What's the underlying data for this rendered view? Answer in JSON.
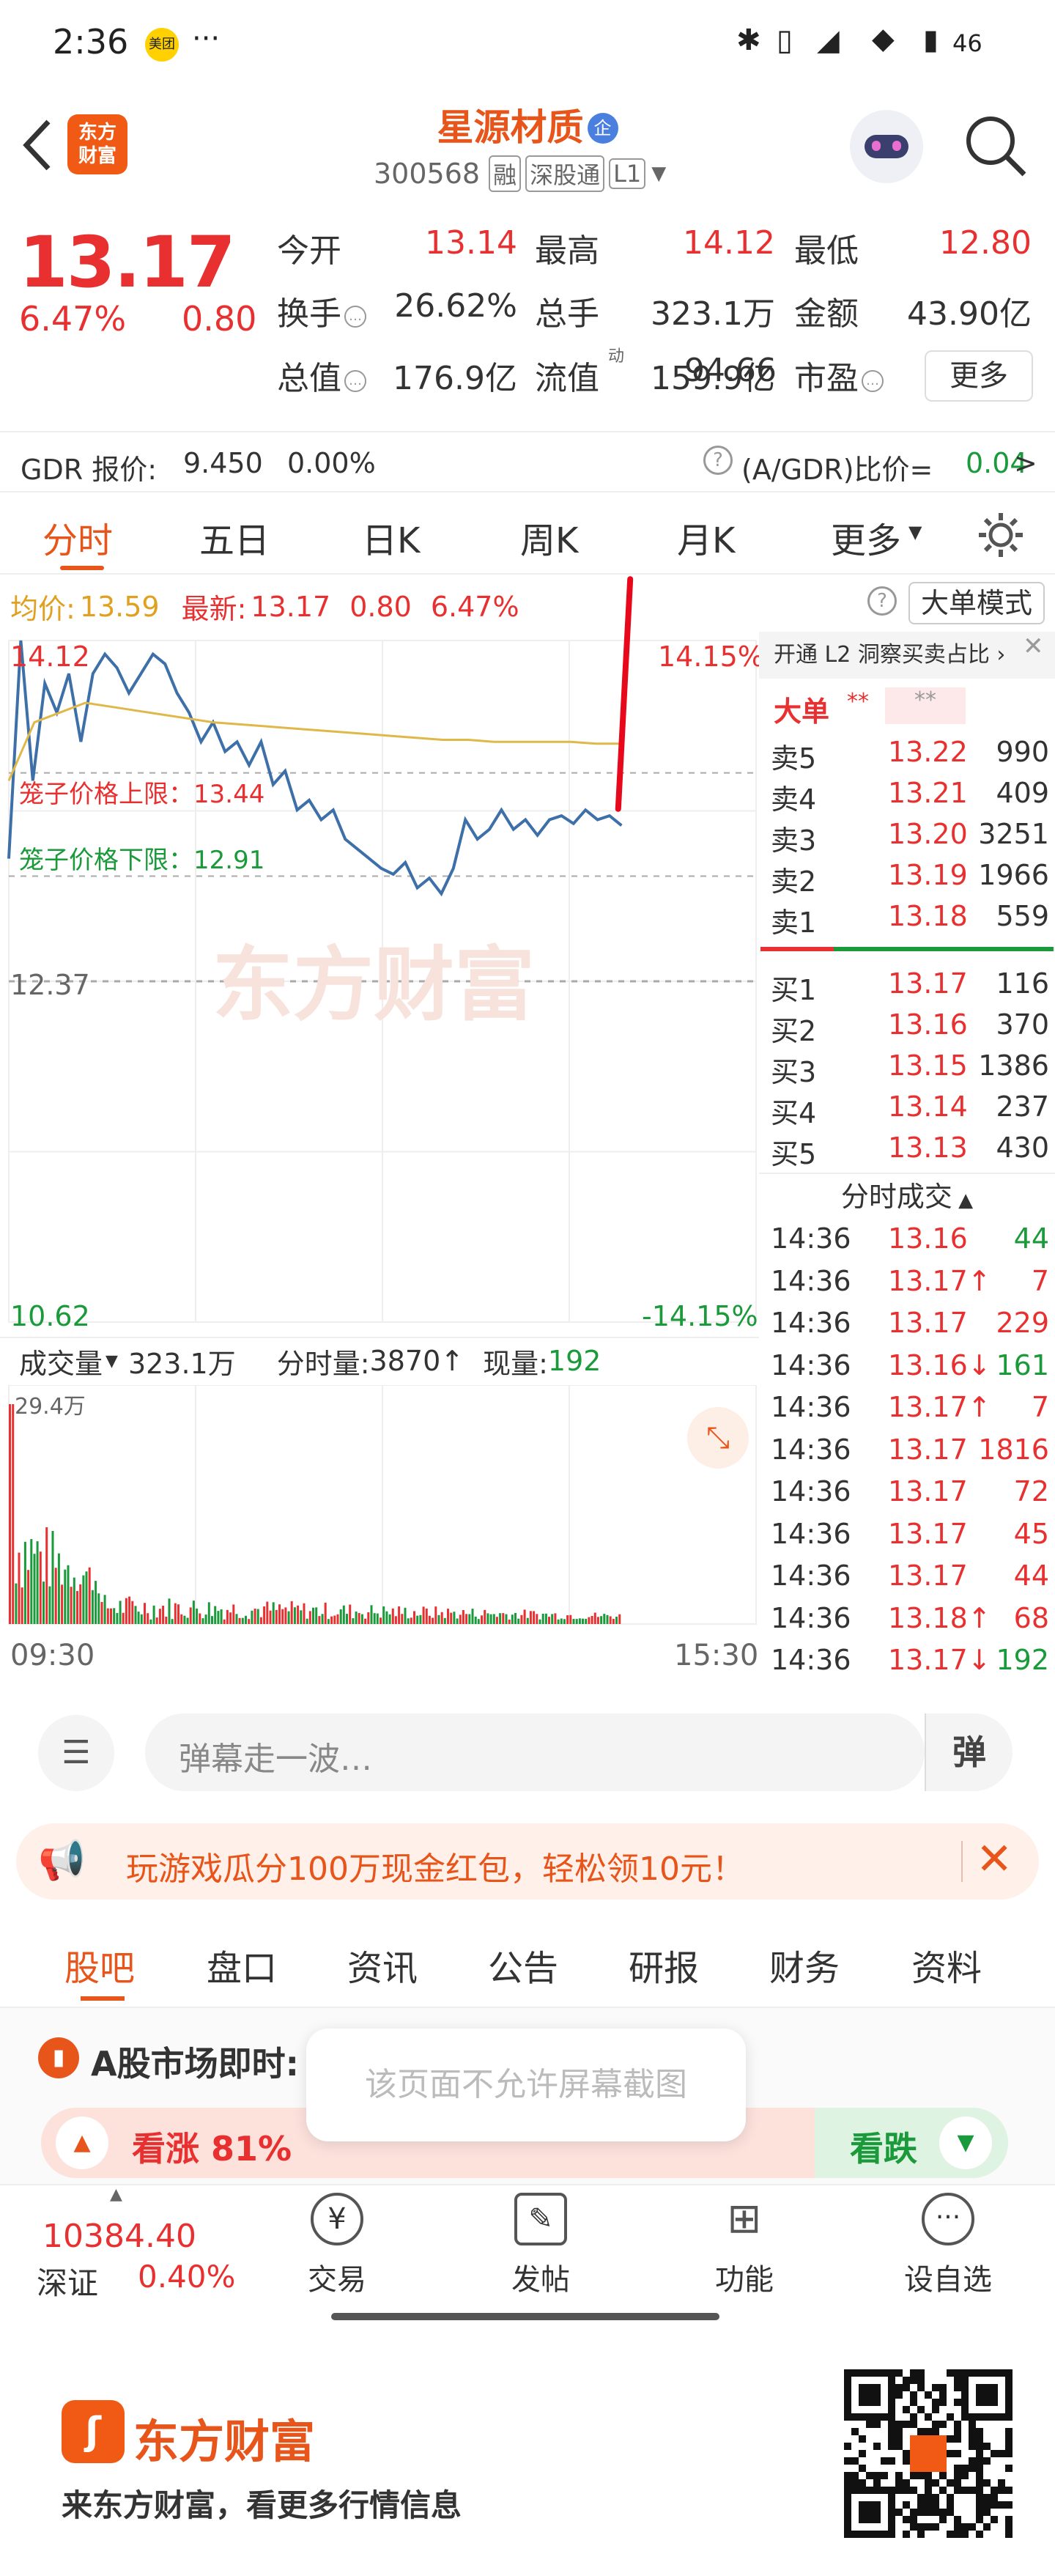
{
  "status_bar": {
    "time": "2:36",
    "app_badge": "美团",
    "more": "···",
    "battery": "46"
  },
  "header": {
    "back_icon": "chevron-left-icon",
    "logo_text": "东方\n财富",
    "stock_name": "星源材质",
    "badge": "企",
    "stock_code": "300568",
    "tag_margin": "融",
    "tag_connect": "深股通",
    "tag_level": "L1",
    "search_icon": "search-icon"
  },
  "quote": {
    "price": "13.17",
    "change_pct": "6.47%",
    "change": "0.80",
    "rows": [
      [
        {
          "label": "今开",
          "value": "13.14",
          "color": "#e93030"
        },
        {
          "label": "最高",
          "value": "14.12",
          "color": "#e93030"
        },
        {
          "label": "最低",
          "value": "12.80",
          "color": "#e93030"
        }
      ],
      [
        {
          "label": "换手",
          "value": "26.62%",
          "color": "#333333"
        },
        {
          "label": "总手",
          "value": "323.1万",
          "color": "#333333"
        },
        {
          "label": "金额",
          "value": "43.90亿",
          "color": "#333333"
        }
      ],
      [
        {
          "label": "总值",
          "value": "176.9亿",
          "color": "#333333"
        },
        {
          "label": "流值",
          "value": "159.9亿",
          "color": "#333333"
        },
        {
          "label": "市盈",
          "value": "94.66",
          "color": "#333333"
        }
      ]
    ],
    "pe_superscript": "动",
    "more_button": "更多"
  },
  "gdr": {
    "label": "GDR 报价:",
    "price": "9.450",
    "pct": "0.00%",
    "ratio_label": "(A/GDR)比价=",
    "ratio_value": "0.04",
    "arrow": ">"
  },
  "chart_tabs": [
    "分时",
    "五日",
    "日K",
    "周K",
    "月K",
    "更多"
  ],
  "chart_tab_active": 0,
  "info_bar": {
    "avg_label": "均价:",
    "avg": "13.59",
    "latest_label": "最新:",
    "latest": "13.17",
    "chg": "0.80",
    "pct": "6.47%",
    "big_order_button": "大单模式"
  },
  "chart_labels": {
    "y_top": "14.12",
    "y_top_pct": "14.15%",
    "y_mid": "12.37",
    "y_bottom": "10.62",
    "y_bottom_pct": "-14.15%",
    "cage_upper": "笼子价格上限：13.44",
    "cage_lower": "笼子价格下限：12.91",
    "watermark": "东方财富",
    "vol_label": "成交量",
    "vol_total": "323.1万",
    "period_label": "分时量:",
    "period_vol": "3870",
    "current_label": "现量:",
    "current_vol": "192",
    "vol_max": "29.4万",
    "time_start": "09:30",
    "time_end": "15:30"
  },
  "chart_data": {
    "type": "line",
    "title": "",
    "xlabel": "",
    "ylabel": "",
    "x_range": [
      "09:30",
      "15:30"
    ],
    "ylim": [
      10.62,
      14.12
    ],
    "grid": true,
    "series": [
      {
        "color": "#3d6fa8",
        "values": [
          13.0,
          14.12,
          13.4,
          13.9,
          13.75,
          13.95,
          13.6,
          13.95,
          14.05,
          13.98,
          13.85,
          13.95,
          14.05,
          14.0,
          13.85,
          13.75,
          13.6,
          13.7,
          13.55,
          13.6,
          13.48,
          13.6,
          13.38,
          13.45,
          13.25,
          13.3,
          13.2,
          13.25,
          13.1,
          13.05,
          13.0,
          12.95,
          12.92,
          12.98,
          12.85,
          12.9,
          12.82,
          12.95,
          13.2,
          13.1,
          13.15,
          13.25,
          13.15,
          13.2,
          13.12,
          13.2,
          13.22,
          13.18,
          13.25,
          13.2,
          13.22,
          13.17
        ]
      },
      {
        "color": "#e0b84a",
        "values": [
          13.4,
          13.7,
          13.75,
          13.8,
          13.78,
          13.76,
          13.74,
          13.72,
          13.7,
          13.69,
          13.68,
          13.67,
          13.66,
          13.65,
          13.64,
          13.63,
          13.62,
          13.61,
          13.61,
          13.6,
          13.6,
          13.6,
          13.6,
          13.59,
          13.59
        ]
      }
    ],
    "volume": {
      "max": "29.4万",
      "bars_color_up": "#e93030",
      "bars_color_down": "#1a9a3a"
    }
  },
  "order_book": {
    "header_text": "开通 L2 洞察买卖占比",
    "big_label": "大单",
    "masked": "**",
    "asks": [
      {
        "label": "卖5",
        "price": "13.22",
        "vol": "990"
      },
      {
        "label": "卖4",
        "price": "13.21",
        "vol": "409"
      },
      {
        "label": "卖3",
        "price": "13.20",
        "vol": "3251"
      },
      {
        "label": "卖2",
        "price": "13.19",
        "vol": "1966"
      },
      {
        "label": "卖1",
        "price": "13.18",
        "vol": "559"
      }
    ],
    "bids": [
      {
        "label": "买1",
        "price": "13.17",
        "vol": "116"
      },
      {
        "label": "买2",
        "price": "13.16",
        "vol": "370"
      },
      {
        "label": "买3",
        "price": "13.15",
        "vol": "1386"
      },
      {
        "label": "买4",
        "price": "13.14",
        "vol": "237"
      },
      {
        "label": "买5",
        "price": "13.13",
        "vol": "430"
      }
    ],
    "trades_title": "分时成交",
    "trades": [
      {
        "time": "14:36",
        "price": "13.16",
        "vol": "44",
        "vcolor": "#1a9a3a"
      },
      {
        "time": "14:36",
        "price": "13.17↑",
        "vol": "7",
        "vcolor": "#e93030"
      },
      {
        "time": "14:36",
        "price": "13.17",
        "vol": "229",
        "vcolor": "#e93030"
      },
      {
        "time": "14:36",
        "price": "13.16↓",
        "vol": "161",
        "vcolor": "#1a9a3a"
      },
      {
        "time": "14:36",
        "price": "13.17↑",
        "vol": "7",
        "vcolor": "#e93030"
      },
      {
        "time": "14:36",
        "price": "13.17",
        "vol": "1816",
        "vcolor": "#e93030"
      },
      {
        "time": "14:36",
        "price": "13.17",
        "vol": "72",
        "vcolor": "#e93030"
      },
      {
        "time": "14:36",
        "price": "13.17",
        "vol": "45",
        "vcolor": "#e93030"
      },
      {
        "time": "14:36",
        "price": "13.17",
        "vol": "44",
        "vcolor": "#e93030"
      },
      {
        "time": "14:36",
        "price": "13.18↑",
        "vol": "68",
        "vcolor": "#e93030"
      },
      {
        "time": "14:36",
        "price": "13.17↓",
        "vol": "192",
        "vcolor": "#1a9a3a"
      }
    ]
  },
  "danmu": {
    "placeholder": "弹幕走一波…",
    "button": "弹"
  },
  "banner": {
    "text": "玩游戏瓜分100万现金红包，轻松领10元！"
  },
  "bottom_tabs": [
    "股吧",
    "盘口",
    "资讯",
    "公告",
    "研报",
    "财务",
    "资料"
  ],
  "market": {
    "title": "A股市场即时:",
    "toast": "该页面不允许屏幕截图",
    "up_label": "看涨 81%",
    "down_label": "看跌"
  },
  "bottom_nav": {
    "index_value": "10384.40",
    "index_name": "深证",
    "index_pct": "0.40%",
    "items": [
      "交易",
      "发帖",
      "功能",
      "设自选"
    ]
  },
  "footer": {
    "brand": "东方财富",
    "slogan": "来东方财富，看更多行情信息"
  }
}
